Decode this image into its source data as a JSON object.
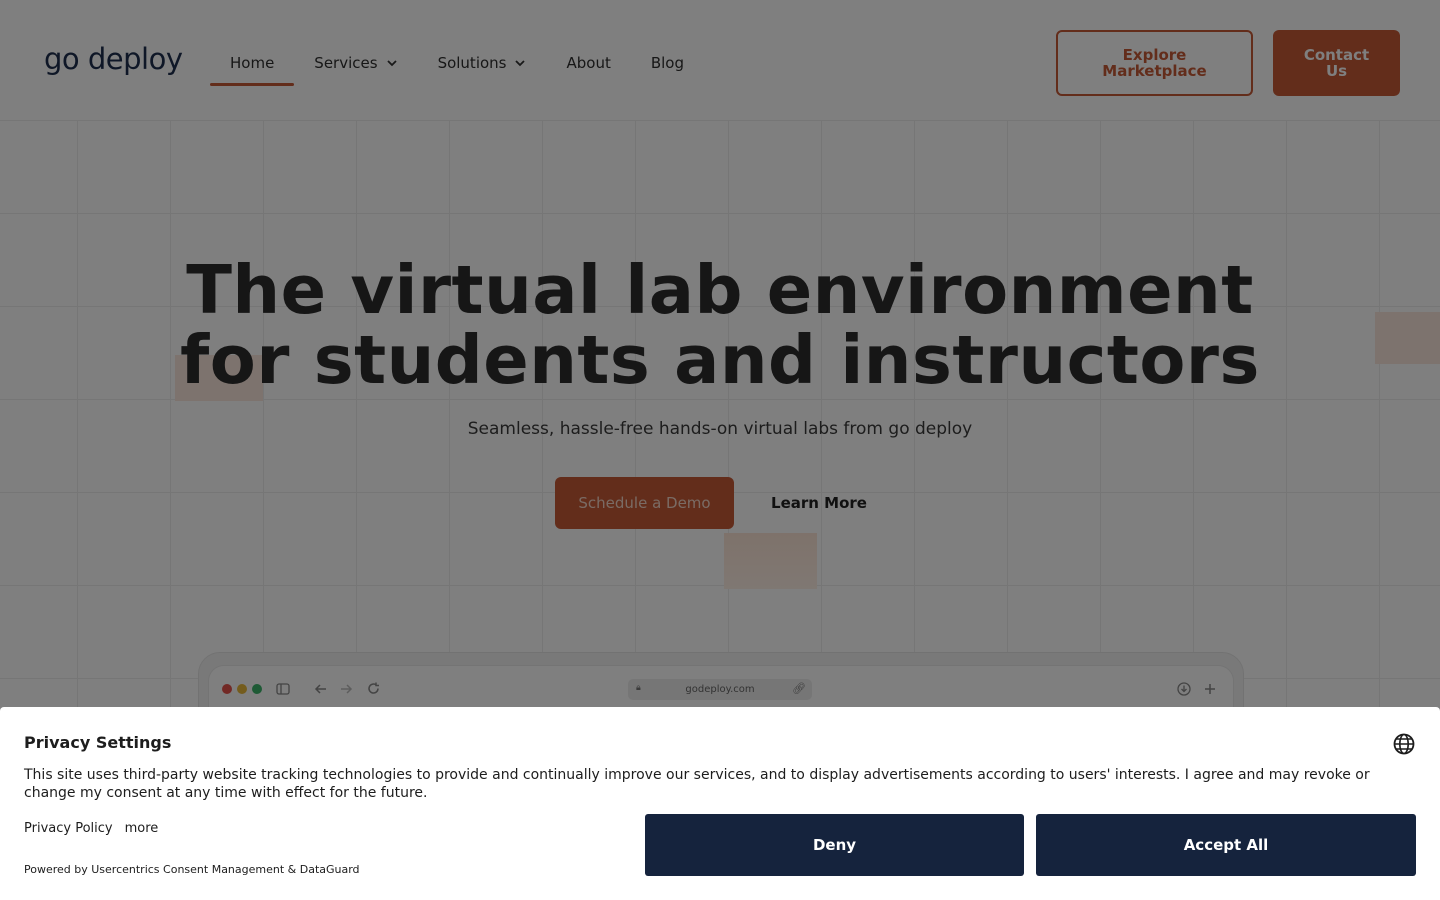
{
  "nav": {
    "logo": "go deploy",
    "links": [
      {
        "label": "Home",
        "active": true,
        "dropdown": false
      },
      {
        "label": "Services",
        "active": false,
        "dropdown": true
      },
      {
        "label": "Solutions",
        "active": false,
        "dropdown": true
      },
      {
        "label": "About",
        "active": false,
        "dropdown": false
      },
      {
        "label": "Blog",
        "active": false,
        "dropdown": false
      }
    ],
    "explore_label": "Explore Marketplace",
    "contact_label": "Contact Us"
  },
  "hero": {
    "title": "The virtual lab environment for students and instructors",
    "subtitle": "Seamless, hassle-free hands-on virtual labs from go deploy",
    "primary_cta": "Schedule a Demo",
    "secondary_cta": "Learn More"
  },
  "browser_mock": {
    "url": "godeploy.com"
  },
  "consent": {
    "title": "Privacy Settings",
    "body": "This site uses third-party website tracking technologies to provide and continually improve our services, and to display advertisements according to users' interests. I agree and may revoke or change my consent at any time with effect for the future.",
    "privacy_policy_label": "Privacy Policy",
    "more_label": "more",
    "powered_by": "Powered by Usercentrics Consent Management & DataGuard",
    "deny_label": "Deny",
    "accept_label": "Accept All"
  },
  "colors": {
    "accent": "#c75a36",
    "navy": "#15233d",
    "overlay": "rgba(0,0,0,0.5)"
  },
  "icons": [
    "chevron-down-icon",
    "globe-icon",
    "lock-icon",
    "link-icon",
    "sidebar-icon",
    "back-arrow-icon",
    "forward-arrow-icon",
    "reload-icon",
    "download-icon",
    "plus-icon"
  ]
}
